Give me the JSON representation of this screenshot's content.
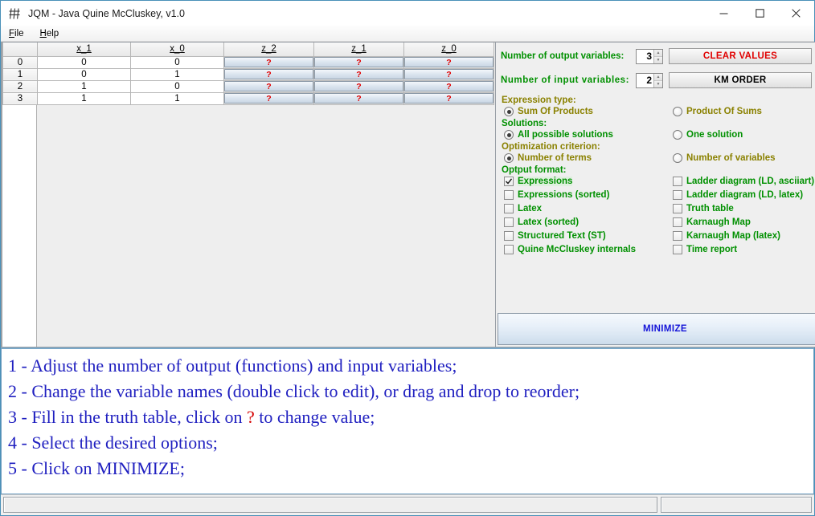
{
  "window": {
    "title": "JQM - Java Quine McCluskey, v1.0",
    "app_icon": "grid-icon",
    "controls": {
      "minimize": "minimize-icon",
      "maximize": "maximize-icon",
      "close": "close-icon"
    }
  },
  "menubar": {
    "items": [
      {
        "label": "File",
        "mnemonic": "F",
        "rest": "ile"
      },
      {
        "label": "Help",
        "mnemonic": "H",
        "rest": "elp"
      }
    ]
  },
  "truth_table": {
    "corner_header": "",
    "columns": [
      "x_1",
      "x_0",
      "z_2",
      "z_1",
      "z_0"
    ],
    "input_columns": [
      "x_1",
      "x_0"
    ],
    "output_columns": [
      "z_2",
      "z_1",
      "z_0"
    ],
    "rows": [
      {
        "index": "0",
        "inputs": [
          "0",
          "0"
        ],
        "outputs": [
          "?",
          "?",
          "?"
        ]
      },
      {
        "index": "1",
        "inputs": [
          "0",
          "1"
        ],
        "outputs": [
          "?",
          "?",
          "?"
        ]
      },
      {
        "index": "2",
        "inputs": [
          "1",
          "0"
        ],
        "outputs": [
          "?",
          "?",
          "?"
        ]
      },
      {
        "index": "3",
        "inputs": [
          "1",
          "1"
        ],
        "outputs": [
          "?",
          "?",
          "?"
        ]
      }
    ]
  },
  "options": {
    "output_vars": {
      "label": "Number of output variables:",
      "value": "3"
    },
    "input_vars": {
      "label": "Number  of  input  variables:",
      "value": "2"
    },
    "clear_values_button": "CLEAR VALUES",
    "km_order_button": "KM ORDER",
    "expression_type": {
      "label": "Expression type:",
      "options": [
        {
          "label": "Sum Of Products",
          "selected": true
        },
        {
          "label": "Product Of Sums",
          "selected": false
        }
      ]
    },
    "solutions": {
      "label": "Solutions:",
      "options": [
        {
          "label": "All possible solutions",
          "selected": true
        },
        {
          "label": "One solution",
          "selected": false
        }
      ]
    },
    "optimization_criterion": {
      "label": "Optimization criterion:",
      "options": [
        {
          "label": "Number of terms",
          "selected": true
        },
        {
          "label": "Number of variables",
          "selected": false
        }
      ]
    },
    "output_format": {
      "label": "Optput format:",
      "left_column": [
        {
          "label": "Expressions",
          "checked": true
        },
        {
          "label": "Expressions (sorted)",
          "checked": false
        },
        {
          "label": "Latex",
          "checked": false
        },
        {
          "label": "Latex (sorted)",
          "checked": false
        },
        {
          "label": "Structured Text (ST)",
          "checked": false
        },
        {
          "label": "Quine McCluskey internals",
          "checked": false
        }
      ],
      "right_column": [
        {
          "label": "Ladder diagram (LD, asciiart)",
          "checked": false
        },
        {
          "label": "Ladder diagram (LD, latex)",
          "checked": false
        },
        {
          "label": "Truth table",
          "checked": false
        },
        {
          "label": "Karnaugh Map",
          "checked": false
        },
        {
          "label": "Karnaugh Map (latex)",
          "checked": false
        },
        {
          "label": "Time report",
          "checked": false
        }
      ]
    },
    "minimize_button": "MINIMIZE"
  },
  "instructions": {
    "line1": "1 - Adjust the number of output (functions) and input variables;",
    "line2": "2 - Change the variable names (double click to edit), or drag and drop to reorder;",
    "line3_a": "3 - Fill in the truth table, click on ",
    "line3_q": "?",
    "line3_b": " to change value;",
    "line4": "4 - Select the desired options;",
    "line5": "5 - Click on MINIMIZE;"
  },
  "statusbar": {
    "main": "",
    "side": ""
  },
  "colors": {
    "green": "#009000",
    "olive": "#8a8100",
    "red": "#e00000",
    "blue": "#2020c0",
    "button_blue": "#1414d8",
    "window_border": "#4a90b8"
  }
}
